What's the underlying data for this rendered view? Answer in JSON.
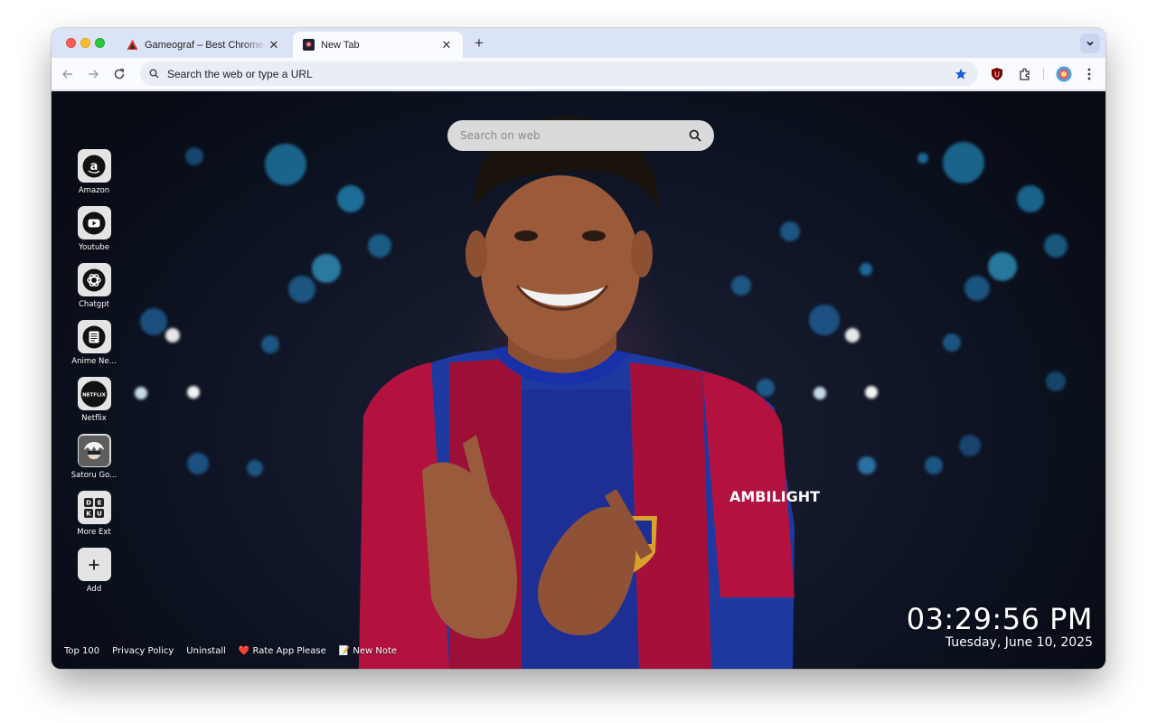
{
  "browser": {
    "tabs": [
      {
        "title": "Gameograf – Best Chrome Li",
        "active": false
      },
      {
        "title": "New Tab",
        "active": true
      }
    ],
    "omnibox_placeholder": "Search the web or type a URL"
  },
  "page": {
    "search_placeholder": "Search on web",
    "shortcuts": [
      {
        "label": "Amazon",
        "icon": "amazon-icon"
      },
      {
        "label": "Youtube",
        "icon": "youtube-icon"
      },
      {
        "label": "Chatgpt",
        "icon": "chatgpt-icon"
      },
      {
        "label": "Anime Ne...",
        "icon": "anime-news-icon"
      },
      {
        "label": "Netflix",
        "icon": "netflix-icon"
      },
      {
        "label": "Satoru Go...",
        "icon": "satoru-gojo-icon"
      },
      {
        "label": "More Ext",
        "icon": "more-ext-icon"
      },
      {
        "label": "Add",
        "icon": "plus-icon"
      }
    ],
    "footer": {
      "top100": "Top 100",
      "privacy": "Privacy Policy",
      "uninstall": "Uninstall",
      "rate": "❤️ Rate App Please",
      "note": "📝 New Note"
    },
    "clock": {
      "time": "03:29:56 PM",
      "date": "Tuesday, June 10, 2025"
    },
    "netflix_logo_text": "NETFLIX",
    "more_ext_letters": "D E K U",
    "jersey_text": "AMBILIGHT"
  }
}
